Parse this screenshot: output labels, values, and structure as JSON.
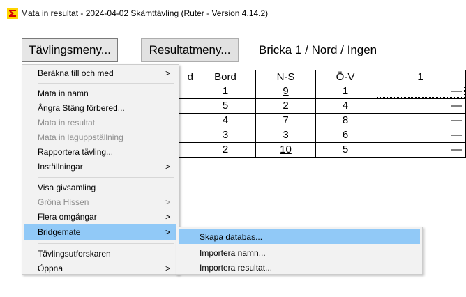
{
  "window": {
    "title": "Mata in resultat - 2024-04-02  Skämttävling  (Ruter - Version 4.14.2)"
  },
  "toolbar": {
    "tavlingsmeny_label": "Tävlingsmeny...",
    "resultatmeny_label": "Resultatmeny...",
    "round_label": "Bricka 1 / Nord / Ingen"
  },
  "grid": {
    "partial_header": "d",
    "headers": [
      "Bord",
      "N-S",
      "Ö-V",
      "1"
    ],
    "rows": [
      {
        "bord": "1",
        "ns": "9",
        "ov": "1",
        "res": "—"
      },
      {
        "bord": "5",
        "ns": "2",
        "ov": "4",
        "res": "—"
      },
      {
        "bord": "4",
        "ns": "7",
        "ov": "8",
        "res": "—"
      },
      {
        "bord": "3",
        "ns": "3",
        "ov": "6",
        "res": "—"
      },
      {
        "bord": "2",
        "ns": "10",
        "ov": "5",
        "res": "—"
      }
    ]
  },
  "menu": {
    "items": [
      {
        "label": "Beräkna till och med",
        "arrow": ">",
        "enabled": true
      },
      {
        "label": "Mata in namn",
        "enabled": true
      },
      {
        "label": "Ångra Stäng förbered...",
        "enabled": true
      },
      {
        "label": "Mata in resultat",
        "enabled": false
      },
      {
        "label": "Mata in laguppställning",
        "enabled": false
      },
      {
        "label": "Rapportera tävling...",
        "enabled": true
      },
      {
        "label": "Inställningar",
        "arrow": ">",
        "enabled": true
      },
      {
        "label": "Visa givsamling",
        "enabled": true
      },
      {
        "label": "Gröna Hissen",
        "arrow": ">",
        "enabled": false
      },
      {
        "label": "Flera omgångar",
        "arrow": ">",
        "enabled": true
      },
      {
        "label": "Bridgemate",
        "arrow": ">",
        "enabled": true,
        "highlighted": true
      },
      {
        "label": "Tävlingsutforskaren",
        "enabled": true
      },
      {
        "label": "Öppna",
        "arrow": ">",
        "enabled": true
      }
    ]
  },
  "submenu": {
    "items": [
      {
        "label": "Skapa databas...",
        "highlighted": true
      },
      {
        "label": "Importera namn..."
      },
      {
        "label": "Importera resultat..."
      }
    ]
  },
  "colors": {
    "highlight": "#91c9f7",
    "disabled_text": "#8d8d8d",
    "menu_bg": "#f2f2f2"
  }
}
